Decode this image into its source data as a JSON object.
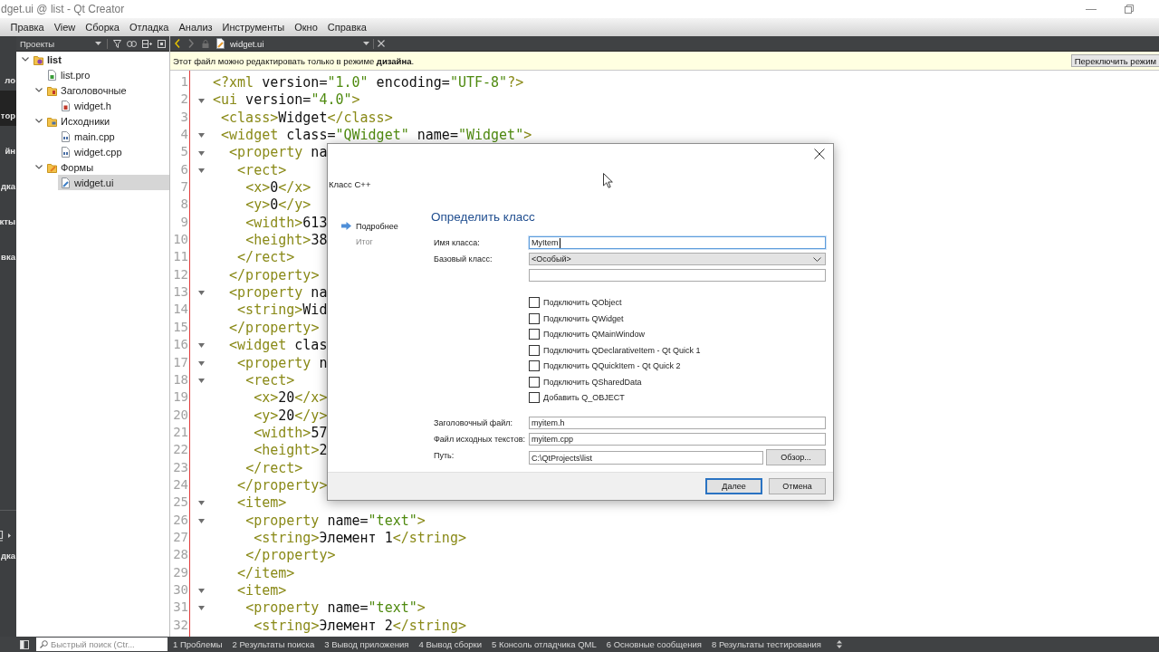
{
  "window": {
    "title": "dget.ui @ list - Qt Creator"
  },
  "menu": [
    "Правка",
    "View",
    "Сборка",
    "Отладка",
    "Анализ",
    "Инструменты",
    "Окно",
    "Справка"
  ],
  "mode_bar": {
    "modes": [
      {
        "label": "ло",
        "selected": false
      },
      {
        "label": "тор",
        "selected": true
      },
      {
        "label": "йн",
        "selected": false
      },
      {
        "label": "дка",
        "selected": false
      },
      {
        "label": "кты",
        "selected": false
      },
      {
        "label": "вка",
        "selected": false
      }
    ],
    "kit": {
      "label": "дка"
    }
  },
  "projects": {
    "title": "Проекты",
    "tree": [
      {
        "label": "list",
        "kind": "project",
        "selected": false,
        "expanded": true,
        "children": [
          {
            "label": "list.pro",
            "kind": "pro-file",
            "selected": false
          },
          {
            "label": "Заголовочные",
            "kind": "header-folder",
            "selected": false,
            "expanded": true,
            "children": [
              {
                "label": "widget.h",
                "kind": "header-file",
                "selected": false
              }
            ]
          },
          {
            "label": "Исходники",
            "kind": "source-folder",
            "selected": false,
            "expanded": true,
            "children": [
              {
                "label": "main.cpp",
                "kind": "source-file",
                "selected": false
              },
              {
                "label": "widget.cpp",
                "kind": "source-file",
                "selected": false
              }
            ]
          },
          {
            "label": "Формы",
            "kind": "form-folder",
            "selected": false,
            "expanded": true,
            "children": [
              {
                "label": "widget.ui",
                "kind": "form-file",
                "selected": true
              }
            ]
          }
        ]
      }
    ]
  },
  "editor": {
    "document": "widget.ui",
    "info_bar": {
      "text": "Этот файл можно редактировать только в режиме **дизайна**.",
      "button": "Переключить режим"
    },
    "lines": [
      {
        "number": "1",
        "fold": false,
        "code": "<?xml version=\"1.0\" encoding=\"UTF-8\"?>"
      },
      {
        "number": "2",
        "fold": true,
        "code": "<ui version=\"4.0\">"
      },
      {
        "number": "3",
        "fold": false,
        "code": " <class>Widget</class>"
      },
      {
        "number": "4",
        "fold": true,
        "code": " <widget class=\"QWidget\" name=\"Widget\">"
      },
      {
        "number": "5",
        "fold": true,
        "code": "  <property na"
      },
      {
        "number": "6",
        "fold": true,
        "code": "   <rect>"
      },
      {
        "number": "7",
        "fold": false,
        "code": "    <x>0</x>"
      },
      {
        "number": "8",
        "fold": false,
        "code": "    <y>0</y>"
      },
      {
        "number": "9",
        "fold": false,
        "code": "    <width>613"
      },
      {
        "number": "10",
        "fold": false,
        "code": "    <height>38"
      },
      {
        "number": "11",
        "fold": false,
        "code": "   </rect>"
      },
      {
        "number": "12",
        "fold": false,
        "code": "  </property>"
      },
      {
        "number": "13",
        "fold": true,
        "code": "  <property na"
      },
      {
        "number": "14",
        "fold": false,
        "code": "   <string>Wid"
      },
      {
        "number": "15",
        "fold": false,
        "code": "  </property>"
      },
      {
        "number": "16",
        "fold": true,
        "code": "  <widget clas"
      },
      {
        "number": "17",
        "fold": true,
        "code": "   <property n"
      },
      {
        "number": "18",
        "fold": true,
        "code": "    <rect>"
      },
      {
        "number": "19",
        "fold": false,
        "code": "     <x>20</x>"
      },
      {
        "number": "20",
        "fold": false,
        "code": "     <y>20</y>"
      },
      {
        "number": "21",
        "fold": false,
        "code": "     <width>57"
      },
      {
        "number": "22",
        "fold": false,
        "code": "     <height>2"
      },
      {
        "number": "23",
        "fold": false,
        "code": "    </rect>"
      },
      {
        "number": "24",
        "fold": false,
        "code": "   </property>"
      },
      {
        "number": "25",
        "fold": true,
        "code": "   <item>"
      },
      {
        "number": "26",
        "fold": true,
        "code": "    <property name=\"text\">"
      },
      {
        "number": "27",
        "fold": false,
        "code": "     <string>Элемент 1</string>"
      },
      {
        "number": "28",
        "fold": false,
        "code": "    </property>"
      },
      {
        "number": "29",
        "fold": false,
        "code": "   </item>"
      },
      {
        "number": "30",
        "fold": true,
        "code": "   <item>"
      },
      {
        "number": "31",
        "fold": true,
        "code": "    <property name=\"text\">"
      },
      {
        "number": "32",
        "fold": false,
        "code": "     <string>Элемент 2</string>"
      }
    ]
  },
  "dialog": {
    "title": "Класс C++",
    "steps": [
      {
        "label": "Подробнее",
        "selected": true
      },
      {
        "label": "Итог",
        "selected": false
      }
    ],
    "heading": "Определить класс",
    "fields": [
      {
        "kind": "text",
        "label": "Имя класса:",
        "value": "MyItem",
        "focused": true
      },
      {
        "kind": "combo",
        "label": "Базовый класс:",
        "value": "<Особый>",
        "focused": false
      },
      {
        "kind": "text",
        "focused": false
      }
    ],
    "checkboxes": [
      {
        "label": "Подключить QObject",
        "checked": false
      },
      {
        "label": "Подключить QWidget",
        "checked": false
      },
      {
        "label": "Подключить QMainWindow",
        "checked": false
      },
      {
        "label": "Подключить QDeclarativeItem - Qt Quick 1",
        "checked": false
      },
      {
        "label": "Подключить QQuickItem - Qt Quick 2",
        "checked": false
      },
      {
        "label": "Подключить QSharedData",
        "checked": false
      },
      {
        "label": "Добавить Q_OBJECT",
        "checked": false
      }
    ],
    "file_fields": [
      {
        "kind": "text",
        "label": "Заголовочный файл:",
        "value": "myitem.h",
        "focused": false
      },
      {
        "kind": "text",
        "label": "Файл исходных текстов:",
        "value": "myitem.cpp",
        "focused": false
      },
      {
        "kind": "path",
        "label": "Путь:",
        "value": "C:\\QtProjects\\list",
        "button": "Обзор...",
        "focused": false
      }
    ],
    "buttons": [
      {
        "label": "Далее",
        "default": true
      },
      {
        "label": "Отмена",
        "default": false
      }
    ]
  },
  "status_bar": {
    "search": {
      "placeholder": "Быстрый поиск (Ctr..."
    },
    "panes": [
      "1 Проблемы",
      "2 Результаты поиска",
      "3 Вывод приложения",
      "4 Вывод сборки",
      "5 Консоль отладчика QML",
      "6 Основные сообщения",
      "8 Результаты тестирования"
    ]
  }
}
